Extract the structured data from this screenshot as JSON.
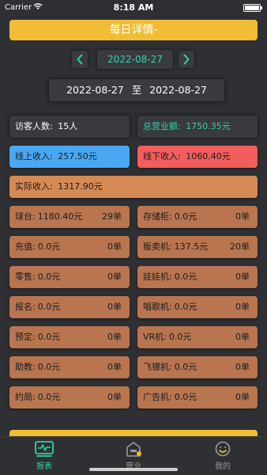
{
  "status_bar": {
    "carrier": "Carrier",
    "time": "8:18 AM"
  },
  "header": {
    "title": "每日详情-"
  },
  "date_nav": {
    "prev_icon": "chevron-left",
    "date": "2022-08-27",
    "next_icon": "chevron-right"
  },
  "range": {
    "start": "2022-08-27",
    "sep": "至",
    "end": "2022-08-27"
  },
  "visitors": {
    "label": "访客人数:",
    "value": "15人"
  },
  "total_revenue": {
    "label": "总营业额:",
    "value": "1750.35元"
  },
  "online_income": {
    "label": "线上收入:",
    "value": "257.50元"
  },
  "offline_income": {
    "label": "线下收入:",
    "value": "1060.40元"
  },
  "actual_income": {
    "label": "实际收入:",
    "value": "1317.90元"
  },
  "left_items": [
    {
      "label": "球台:",
      "value": "1180.40元",
      "count": "29单"
    },
    {
      "label": "充值:",
      "value": "0.0元",
      "count": "0单"
    },
    {
      "label": "零售:",
      "value": "0.0元",
      "count": "0单"
    },
    {
      "label": "报名:",
      "value": "0.0元",
      "count": "0单"
    },
    {
      "label": "预定:",
      "value": "0.0元",
      "count": "0单"
    },
    {
      "label": "助教:",
      "value": "0.0元",
      "count": "0单"
    },
    {
      "label": "约局:",
      "value": "0.0元",
      "count": "0单"
    }
  ],
  "right_items": [
    {
      "label": "存储柜:",
      "value": "0.0元",
      "count": "0单"
    },
    {
      "label": "贩卖机:",
      "value": "137.5元",
      "count": "20单"
    },
    {
      "label": "娃娃机:",
      "value": "0.0元",
      "count": "0单"
    },
    {
      "label": "唱歌机:",
      "value": "0.0元",
      "count": "0单"
    },
    {
      "label": "VR机:",
      "value": "0.0元",
      "count": "0单"
    },
    {
      "label": "飞镖机:",
      "value": "0.0元",
      "count": "0单"
    },
    {
      "label": "广告机:",
      "value": "0.0元",
      "count": "0单"
    }
  ],
  "tabs": [
    {
      "label": "报表",
      "icon": "report-icon",
      "active": true
    },
    {
      "label": "营业",
      "icon": "store-icon",
      "active": false
    },
    {
      "label": "我的",
      "icon": "profile-icon",
      "active": false
    }
  ],
  "colors": {
    "background": "#2f3033",
    "accent_yellow": "#f0bd35",
    "accent_green": "#2ed3a8",
    "online_blue": "#4aa8f2",
    "offline_red": "#f25d5d",
    "actual_orange": "#d58a55",
    "item_brown": "#b87550"
  }
}
